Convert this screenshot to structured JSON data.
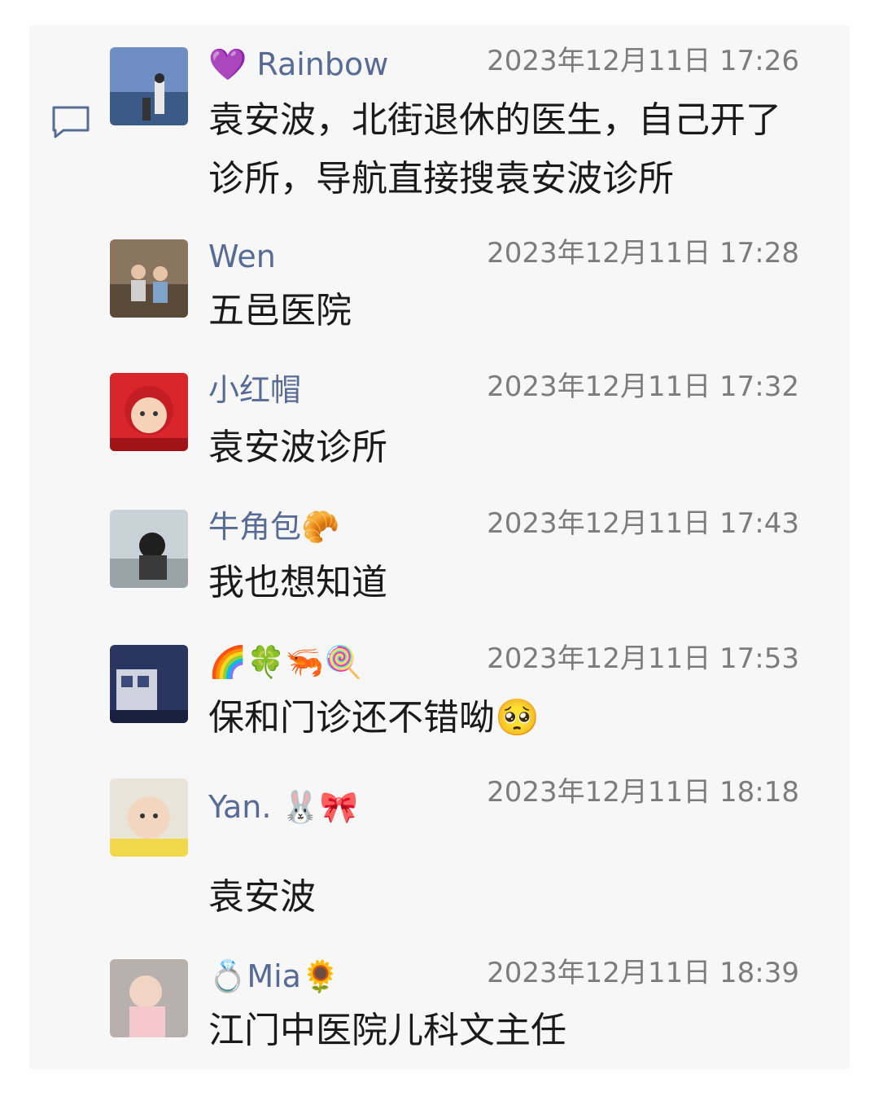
{
  "comments": [
    {
      "name": "💜 Rainbow",
      "time": "2023年12月11日 17:26",
      "text": "袁安波，北街退休的医生，自己开了诊所，导航直接搜袁安波诊所"
    },
    {
      "name": "Wen",
      "time": "2023年12月11日 17:28",
      "text": "五邑医院"
    },
    {
      "name": "小红帽",
      "time": "2023年12月11日 17:32",
      "text": "袁安波诊所"
    },
    {
      "name": "牛角包🥐",
      "time": "2023年12月11日 17:43",
      "text": "我也想知道"
    },
    {
      "name": "🌈🍀🦐🍭",
      "time": "2023年12月11日 17:53",
      "text": "保和门诊还不错呦🥺"
    },
    {
      "name": "Yan. 🐰🎀",
      "time": "2023年12月11日 18:18",
      "text": "袁安波"
    },
    {
      "name": "💍Mia🌻",
      "time": "2023年12月11日 18:39",
      "text": "江门中医院儿科文主任"
    }
  ],
  "icons": {
    "comment": "comment-bubble-icon"
  },
  "colors": {
    "name": "#576b95",
    "time": "#7c7c7c",
    "background": "#f7f7f7"
  }
}
